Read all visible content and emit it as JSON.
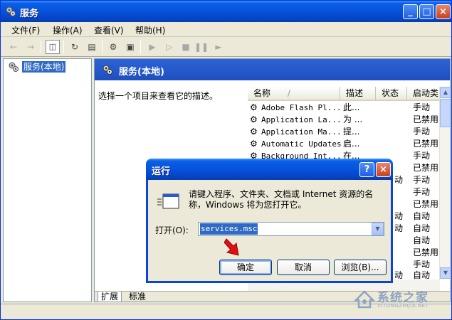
{
  "window": {
    "title": "服务",
    "caption_buttons": [
      "_",
      "□",
      "×"
    ]
  },
  "menu": [
    "文件(F)",
    "操作(A)",
    "查看(V)",
    "帮助(H)"
  ],
  "tree": {
    "root": "服务(本地)"
  },
  "pane": {
    "header": "服务(本地)",
    "description": "选择一个项目来查看它的描述。",
    "columns": [
      "名称",
      "描述",
      "状态",
      "启动类"
    ],
    "rows": [
      {
        "name": "Adobe Flash Pl...",
        "desc": "此...",
        "status": "",
        "startup": "手动"
      },
      {
        "name": "Application La...",
        "desc": "为 ...",
        "status": "",
        "startup": "已禁用"
      },
      {
        "name": "Application Ma...",
        "desc": "提...",
        "status": "",
        "startup": "手动"
      },
      {
        "name": "Automatic Updates",
        "desc": "启...",
        "status": "",
        "startup": "已禁用"
      },
      {
        "name": "Background Int...",
        "desc": "在...",
        "status": "",
        "startup": "手动"
      }
    ],
    "hidden_rows_startup": [
      "已禁用",
      "手动",
      "手动",
      "已禁用",
      "自动",
      "自动",
      "自动",
      "已禁用",
      "手动",
      "自动"
    ],
    "hidden_rows_suffix": [
      "",
      "动",
      "",
      "",
      "动",
      "动",
      "",
      "",
      "",
      "动"
    ],
    "tabs": [
      "扩展",
      "标准"
    ]
  },
  "dialog": {
    "title": "运行",
    "help_button": "?",
    "close_button": "×",
    "prompt": "请键入程序、文件夹、文档或 Internet 资源的名称，Windows 将为您打开它。",
    "open_label": "打开(O):",
    "open_value": "services.msc",
    "ok": "确定",
    "cancel": "取消",
    "browse": "浏览(B)..."
  },
  "watermark": {
    "brand": "系统之家",
    "sub": "XITONGZHIJIA.NET"
  }
}
